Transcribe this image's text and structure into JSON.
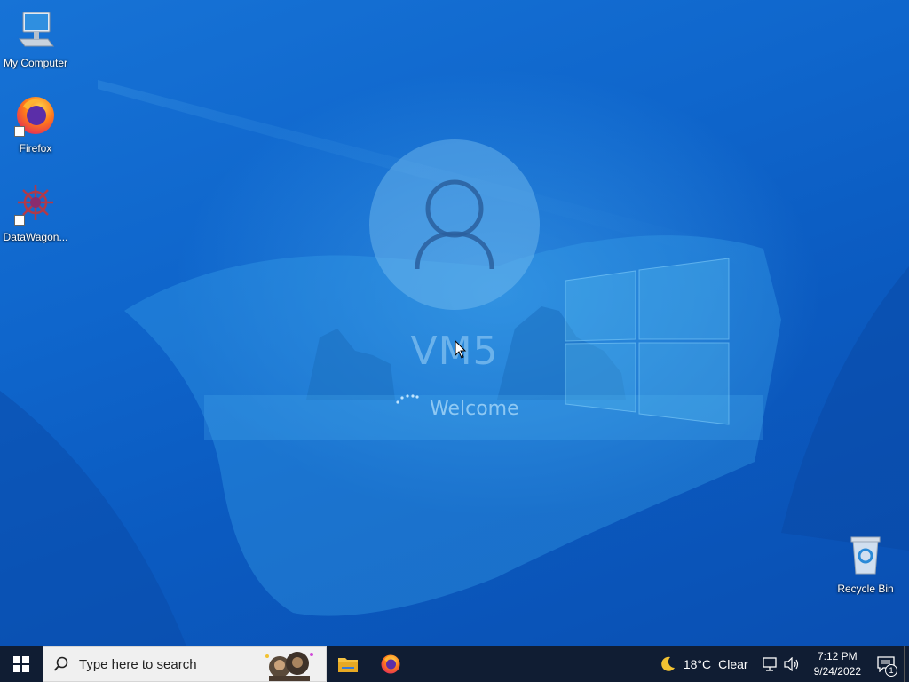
{
  "desktop": {
    "icons": [
      {
        "label": "My Computer",
        "icon": "computer-icon"
      },
      {
        "label": "Firefox",
        "icon": "firefox-icon",
        "shortcut": true
      },
      {
        "label": "DataWagon...",
        "icon": "datawagon-icon",
        "shortcut": true
      },
      {
        "label": "Recycle Bin",
        "icon": "recycle-bin-icon"
      }
    ]
  },
  "login": {
    "username": "VM5",
    "status": "Welcome"
  },
  "taskbar": {
    "search_placeholder": "Type here to search",
    "apps": [
      {
        "name": "File Explorer",
        "icon": "folder-icon"
      },
      {
        "name": "Firefox",
        "icon": "firefox-icon"
      }
    ],
    "weather": {
      "temp": "18°C",
      "condition": "Clear",
      "icon": "moon-icon"
    },
    "clock": {
      "time": "7:12 PM",
      "date": "9/24/2022"
    },
    "notification_count": "1"
  },
  "colors": {
    "taskbar_bg": "#101d33",
    "wallpaper_blue": "#0f66cc",
    "search_bg": "#f0f0f0"
  }
}
